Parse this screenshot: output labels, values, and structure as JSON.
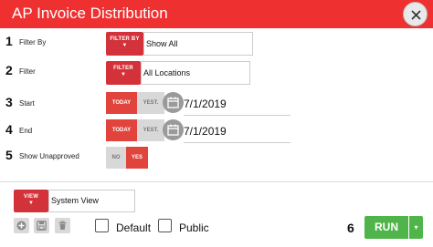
{
  "window": {
    "title": "AP Invoice Distribution",
    "accent": "#ef3030"
  },
  "rows": [
    {
      "number": "1",
      "label": "Filter By",
      "button_label": "FILTER BY",
      "value": "Show All"
    },
    {
      "number": "2",
      "label": "Filter",
      "button_label": "FILTER",
      "value": "All Locations"
    },
    {
      "number": "3",
      "label": "Start",
      "today": "TODAY",
      "yest": "YEST.",
      "date": "7/1/2019",
      "selected": "TODAY"
    },
    {
      "number": "4",
      "label": "End",
      "today": "TODAY",
      "yest": "YEST.",
      "date": "7/1/2019",
      "selected": "TODAY"
    },
    {
      "number": "5",
      "label": "Show Unapproved",
      "no": "NO",
      "yes": "YES",
      "selected": "YES"
    }
  ],
  "view": {
    "button_label": "VIEW",
    "value": "System View"
  },
  "icons": {
    "add": "add-icon",
    "save": "save-icon",
    "delete": "trash-icon",
    "close": "close-icon",
    "calendar": "calendar-icon"
  },
  "options": {
    "default_label": "Default",
    "public_label": "Public",
    "default_checked": false,
    "public_checked": false
  },
  "run": {
    "number": "6",
    "label": "RUN",
    "dropdown": "▾",
    "color": "#4fb54b"
  },
  "caret": "▼"
}
